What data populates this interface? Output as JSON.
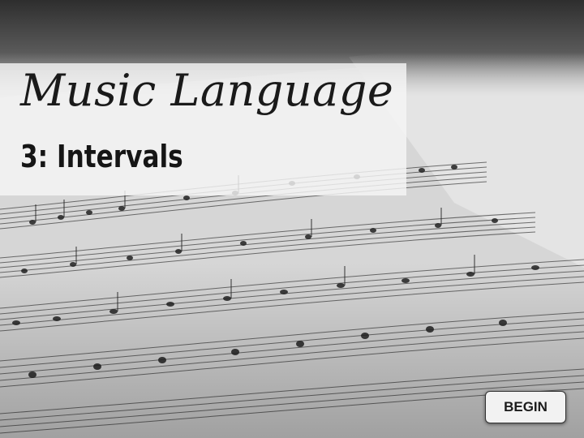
{
  "slide": {
    "title": "Music Language",
    "subtitle": "3: Intervals"
  },
  "controls": {
    "begin_label": "BEGIN"
  },
  "background": {
    "description_icon": "sheet-music-photo-icon"
  }
}
